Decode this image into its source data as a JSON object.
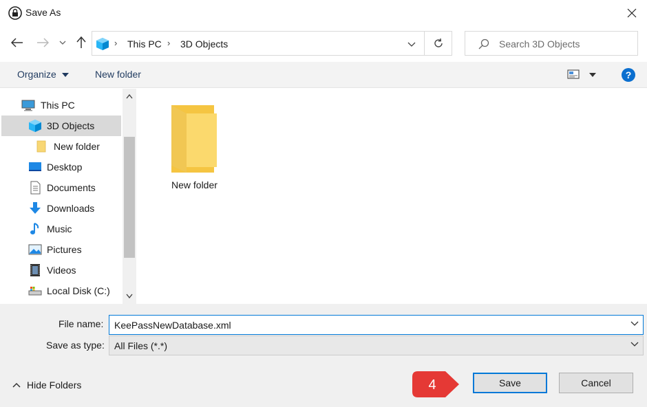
{
  "window": {
    "title": "Save As",
    "close_glyph": "✕"
  },
  "address": {
    "breadcrumbs": [
      "This PC",
      "3D Objects"
    ],
    "search_placeholder": "Search 3D Objects"
  },
  "toolbar": {
    "organize": "Organize",
    "new_folder": "New folder"
  },
  "nav_tree": {
    "items": [
      {
        "label": "This PC",
        "icon": "this-pc-icon"
      },
      {
        "label": "3D Objects",
        "icon": "3d-objects-icon",
        "selected": true
      },
      {
        "label": "New folder",
        "icon": "folder-icon"
      },
      {
        "label": "Desktop",
        "icon": "desktop-icon"
      },
      {
        "label": "Documents",
        "icon": "documents-icon"
      },
      {
        "label": "Downloads",
        "icon": "downloads-icon"
      },
      {
        "label": "Music",
        "icon": "music-icon"
      },
      {
        "label": "Pictures",
        "icon": "pictures-icon"
      },
      {
        "label": "Videos",
        "icon": "videos-icon"
      },
      {
        "label": "Local Disk (C:)",
        "icon": "local-disk-icon"
      }
    ]
  },
  "content": {
    "items": [
      {
        "label": "New folder",
        "icon": "folder-icon"
      }
    ]
  },
  "form": {
    "file_name_label": "File name:",
    "file_name_value": "KeePassNewDatabase.xml",
    "save_type_label": "Save as type:",
    "save_type_value": "All Files (*.*)"
  },
  "footer": {
    "hide_folders": "Hide Folders",
    "save": "Save",
    "cancel": "Cancel",
    "step_badge": "4"
  },
  "colors": {
    "accent": "#0078d7",
    "folder": "#f8d775",
    "badge": "#e53935"
  }
}
